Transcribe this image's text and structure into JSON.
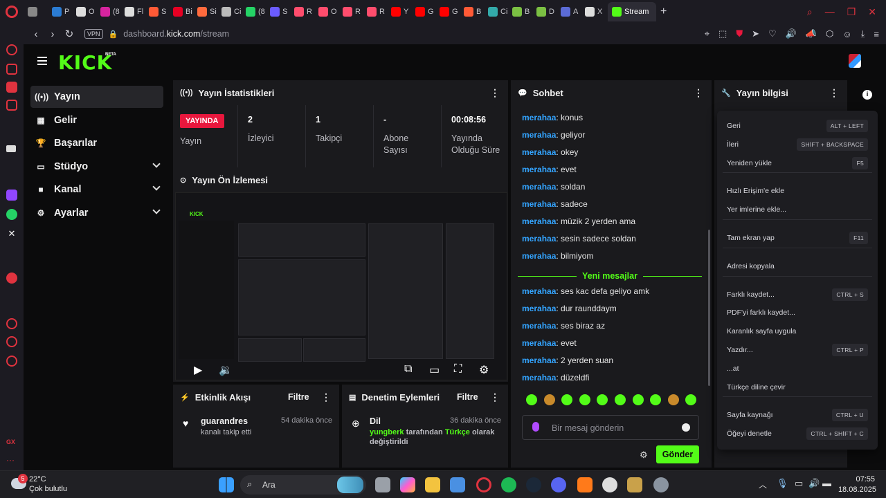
{
  "browser": {
    "tabs": [
      {
        "label": "",
        "color": "#888888"
      },
      {
        "label": "P",
        "color": "#2b7cd3"
      },
      {
        "label": "O",
        "color": "#dddddd"
      },
      {
        "label": "(8",
        "color": "#d6249f"
      },
      {
        "label": "Fl",
        "color": "#dddddd"
      },
      {
        "label": "S",
        "color": "#ff5a36"
      },
      {
        "label": "Bi",
        "color": "#e60023"
      },
      {
        "label": "Si",
        "color": "#ff6a3d"
      },
      {
        "label": "Ci",
        "color": "#bbbbbb"
      },
      {
        "label": "(8",
        "color": "#25d366"
      },
      {
        "label": "S",
        "color": "#6b5cff"
      },
      {
        "label": "R",
        "color": "#ff4d6d"
      },
      {
        "label": "O",
        "color": "#ff4d6d"
      },
      {
        "label": "R",
        "color": "#ff4d6d"
      },
      {
        "label": "R",
        "color": "#ff4d6d"
      },
      {
        "label": "Y",
        "color": "#ff0000"
      },
      {
        "label": "G",
        "color": "#ff0000"
      },
      {
        "label": "G",
        "color": "#ff0000"
      },
      {
        "label": "B",
        "color": "#ff5a36"
      },
      {
        "label": "Ci",
        "color": "#3aa"
      },
      {
        "label": "B",
        "color": "#7bc043"
      },
      {
        "label": "D",
        "color": "#7bc043"
      },
      {
        "label": "A",
        "color": "#5b6bd6"
      },
      {
        "label": "X",
        "color": "#dddddd"
      }
    ],
    "active_tab": "Stream",
    "address_prefix": "dashboard.",
    "address_domain": "kick.com",
    "address_path": "/stream",
    "vpn": "VPN"
  },
  "nav": {
    "items": [
      {
        "label": "Yayın",
        "icon": "((•))",
        "expand": false,
        "active": true
      },
      {
        "label": "Gelir",
        "icon": "▦",
        "expand": false,
        "active": false
      },
      {
        "label": "Başarılar",
        "icon": "🏆",
        "expand": false,
        "active": false
      },
      {
        "label": "Stüdyo",
        "icon": "▭",
        "expand": true,
        "active": false
      },
      {
        "label": "Kanal",
        "icon": "■",
        "expand": true,
        "active": false
      },
      {
        "label": "Ayarlar",
        "icon": "⚙",
        "expand": true,
        "active": false
      }
    ]
  },
  "logo": {
    "text": "KICK",
    "beta": "BETA"
  },
  "stats": {
    "title": "Yayın İstatistikleri",
    "live_badge": "YAYINDA",
    "live_label": "Yayın",
    "viewers_value": "2",
    "viewers_label": "İzleyici",
    "followers_value": "1",
    "followers_label": "Takipçi",
    "subs_value": "-",
    "subs_label": "Abone Sayısı",
    "duration_value": "00:08:56",
    "duration_label": "Yayında Olduğu Süre"
  },
  "preview": {
    "title": "Yayın Ön İzlemesi"
  },
  "chat": {
    "title": "Sohbet",
    "messages_before": [
      {
        "user": "merahaa",
        "text": ": konus"
      },
      {
        "user": "merahaa",
        "text": ": geliyor"
      },
      {
        "user": "merahaa",
        "text": ": okey"
      },
      {
        "user": "merahaa",
        "text": ": evet"
      },
      {
        "user": "merahaa",
        "text": ": soldan"
      },
      {
        "user": "merahaa",
        "text": ": sadece"
      },
      {
        "user": "merahaa",
        "text": ": müzik 2 yerden ama"
      },
      {
        "user": "merahaa",
        "text": ": sesin sadece soldan"
      },
      {
        "user": "merahaa",
        "text": ": bilmiyom"
      }
    ],
    "new_messages": "Yeni mesajlar",
    "messages_after": [
      {
        "user": "merahaa",
        "text": ": ses kac defa geliyo amk"
      },
      {
        "user": "merahaa",
        "text": ": dur raunddaym"
      },
      {
        "user": "merahaa",
        "text": ": ses biraz az"
      },
      {
        "user": "merahaa",
        "text": ": evet"
      },
      {
        "user": "merahaa",
        "text": ": 2 yerden suan"
      },
      {
        "user": "merahaa",
        "text": ": düzeldfi"
      }
    ],
    "input_placeholder": "Bir mesaj gönderin",
    "send_label": "Gönder"
  },
  "info": {
    "title": "Yayın bilgisi"
  },
  "context_menu": {
    "groups": [
      [
        {
          "label": "Geri",
          "shortcut": "ALT + LEFT"
        },
        {
          "label": "İleri",
          "shortcut": "SHİFT + BACKSPACE"
        },
        {
          "label": "Yeniden yükle",
          "shortcut": "F5"
        }
      ],
      [
        {
          "label": "Hızlı Erişim'e ekle",
          "shortcut": ""
        },
        {
          "label": "Yer imlerine ekle...",
          "shortcut": ""
        }
      ],
      [
        {
          "label": "Tam ekran yap",
          "shortcut": "F11"
        }
      ],
      [
        {
          "label": "Adresi kopyala",
          "shortcut": ""
        }
      ],
      [
        {
          "label": "Farklı kaydet...",
          "shortcut": "CTRL + S"
        },
        {
          "label": "PDF'yi farklı kaydet...",
          "shortcut": ""
        },
        {
          "label": "Karanlık sayfa uygula",
          "shortcut": ""
        },
        {
          "label": "Yazdır...",
          "shortcut": "CTRL + P"
        },
        {
          "label": "...at",
          "shortcut": ""
        },
        {
          "label": "Türkçe diline çevir",
          "shortcut": ""
        }
      ],
      [
        {
          "label": "Sayfa kaynağı",
          "shortcut": "CTRL + U"
        },
        {
          "label": "Öğeyi denetle",
          "shortcut": "CTRL + SHİFT + C"
        }
      ]
    ]
  },
  "activity": {
    "title": "Etkinlik Akışı",
    "filter": "Filtre",
    "user": "guarandres",
    "action": "kanalı takip etti",
    "time": "54 dakika önce"
  },
  "moderation": {
    "title": "Denetim Eylemleri",
    "filter": "Filtre",
    "item_title": "Dil",
    "time": "36 dakika önce",
    "actor": "yungberk",
    "mid": " tarafından ",
    "lang": "Türkçe",
    "rest": " olarak",
    "line2": "değiştirildi"
  },
  "taskbar": {
    "weather_temp": "22°C",
    "weather_desc": "Çok bulutlu",
    "weather_badge": "5",
    "search_placeholder": "Ara",
    "time": "07:55",
    "date": "18.08.2025"
  },
  "colors": {
    "brand": "#53fc18",
    "live": "#e8173d",
    "chat_user": "#33a4ff"
  }
}
